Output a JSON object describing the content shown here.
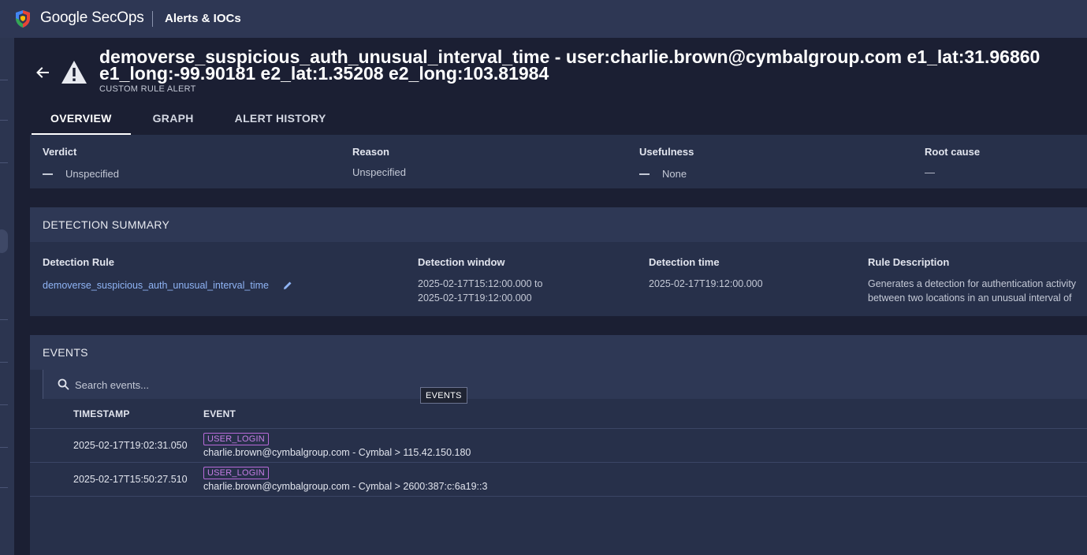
{
  "app": {
    "brand": "Google SecOps",
    "section": "Alerts & IOCs"
  },
  "alert": {
    "title": "demoverse_suspicious_auth_unusual_interval_time - user:charlie.brown@cymbalgroup.com e1_lat:31.96860 e1_long:-99.90181 e2_lat:1.35208 e2_long:103.81984",
    "subtitle": "CUSTOM RULE ALERT"
  },
  "tabs": [
    {
      "label": "OVERVIEW",
      "active": true
    },
    {
      "label": "GRAPH",
      "active": false
    },
    {
      "label": "ALERT HISTORY",
      "active": false
    }
  ],
  "verdict": {
    "verdict_label": "Verdict",
    "verdict_value": "Unspecified",
    "reason_label": "Reason",
    "reason_value": "Unspecified",
    "usefulness_label": "Usefulness",
    "usefulness_value": "None",
    "root_cause_label": "Root cause",
    "root_cause_value": "—"
  },
  "detection_summary": {
    "header": "DETECTION SUMMARY",
    "rule_label": "Detection Rule",
    "rule_value": "demoverse_suspicious_auth_unusual_interval_time",
    "window_label": "Detection window",
    "window_start": "2025-02-17T15:12:00.000 to",
    "window_end": "2025-02-17T19:12:00.000",
    "time_label": "Detection time",
    "time_value": "2025-02-17T19:12:00.000",
    "desc_label": "Rule Description",
    "desc_line1": "Generates a detection for authentication activity",
    "desc_line2": "between two locations in an unusual interval of"
  },
  "events": {
    "header": "EVENTS",
    "search_placeholder": "Search events...",
    "tooltip": "EVENTS",
    "columns": [
      "TIMESTAMP",
      "EVENT"
    ],
    "rows": [
      {
        "timestamp": "2025-02-17T19:02:31.050",
        "badge": "USER_LOGIN",
        "text": "charlie.brown@cymbalgroup.com - Cymbal > 115.42.150.180"
      },
      {
        "timestamp": "2025-02-17T15:50:27.510",
        "badge": "USER_LOGIN",
        "text": "charlie.brown@cymbalgroup.com - Cymbal > 2600:387:c:6a19::3"
      }
    ]
  },
  "colors": {
    "accent_link": "#8fb4f5",
    "badge": "#c77ee6",
    "warning": "#ffffff"
  }
}
